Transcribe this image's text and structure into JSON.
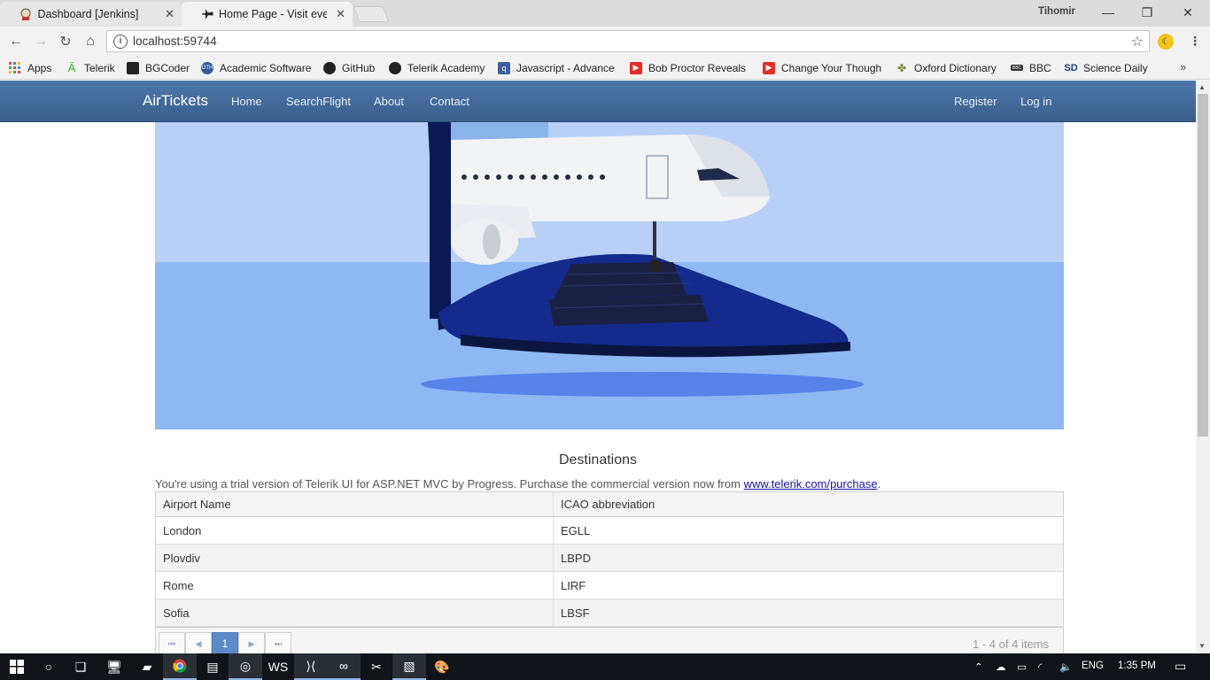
{
  "browser": {
    "tabs": [
      {
        "title": "Dashboard [Jenkins]",
        "close": "✕",
        "icon": "jenkins-icon"
      },
      {
        "title": "Home Page - Visit every",
        "close": "✕",
        "icon": "plane-icon"
      }
    ],
    "user": "Tihomir",
    "url": "localhost:59744",
    "bookmarks": [
      {
        "label": "Apps",
        "icon": "apps-grid-icon",
        "color": "#e8453c"
      },
      {
        "label": "Telerik",
        "icon": "telerik-icon",
        "color": "#5ce500"
      },
      {
        "label": "BGCoder",
        "icon": "bgcoder-icon",
        "color": "#222222"
      },
      {
        "label": "Academic Software",
        "icon": "academic-software-icon",
        "color": "#2f5d9e"
      },
      {
        "label": "GitHub",
        "icon": "github-icon",
        "color": "#222222"
      },
      {
        "label": "Telerik Academy",
        "icon": "github-icon",
        "color": "#222222"
      },
      {
        "label": "Javascript - Advance",
        "icon": "javascript-icon",
        "color": "#3f5f9f"
      },
      {
        "label": "Bob Proctor Reveals",
        "icon": "youtube-icon",
        "color": "#e52d27"
      },
      {
        "label": "Change Your Though",
        "icon": "youtube-icon",
        "color": "#e52d27"
      },
      {
        "label": "Oxford Dictionary",
        "icon": "oxford-icon",
        "color": "#6a8f2a"
      },
      {
        "label": "BBC",
        "icon": "bbc-icon",
        "color": "#333333"
      },
      {
        "label": "Science Daily",
        "icon": "sciencedaily-icon",
        "color": "#1f3f7f"
      }
    ],
    "more": "»"
  },
  "site": {
    "brand": "AirTickets",
    "nav": [
      "Home",
      "SearchFlight",
      "About",
      "Contact"
    ],
    "auth": [
      "Register",
      "Log in"
    ],
    "colors": {
      "navbar": "#4a70a3",
      "hero_sky": "#b8d0f7",
      "hero_floor": "#8db8f2",
      "pager_active": "#5b8ac6"
    }
  },
  "destinations": {
    "title": "Destinations",
    "trial_text": "You're using a trial version of Telerik UI for ASP.NET MVC by Progress. Purchase the commercial version now from ",
    "trial_link": "www.telerik.com/purchase",
    "trial_end": ".",
    "columns": [
      "Airport Name",
      "ICAO abbreviation"
    ],
    "rows": [
      [
        "London",
        "EGLL"
      ],
      [
        "Plovdiv",
        "LBPD"
      ],
      [
        "Rome",
        "LIRF"
      ],
      [
        "Sofia",
        "LBSF"
      ]
    ],
    "pager": {
      "first": "⏮",
      "prev": "◀",
      "page": "1",
      "next": "▶",
      "last": "⏭",
      "info": "1 - 4 of 4 items"
    }
  },
  "taskbar": {
    "lang": "ENG",
    "time": "1:35 PM"
  }
}
